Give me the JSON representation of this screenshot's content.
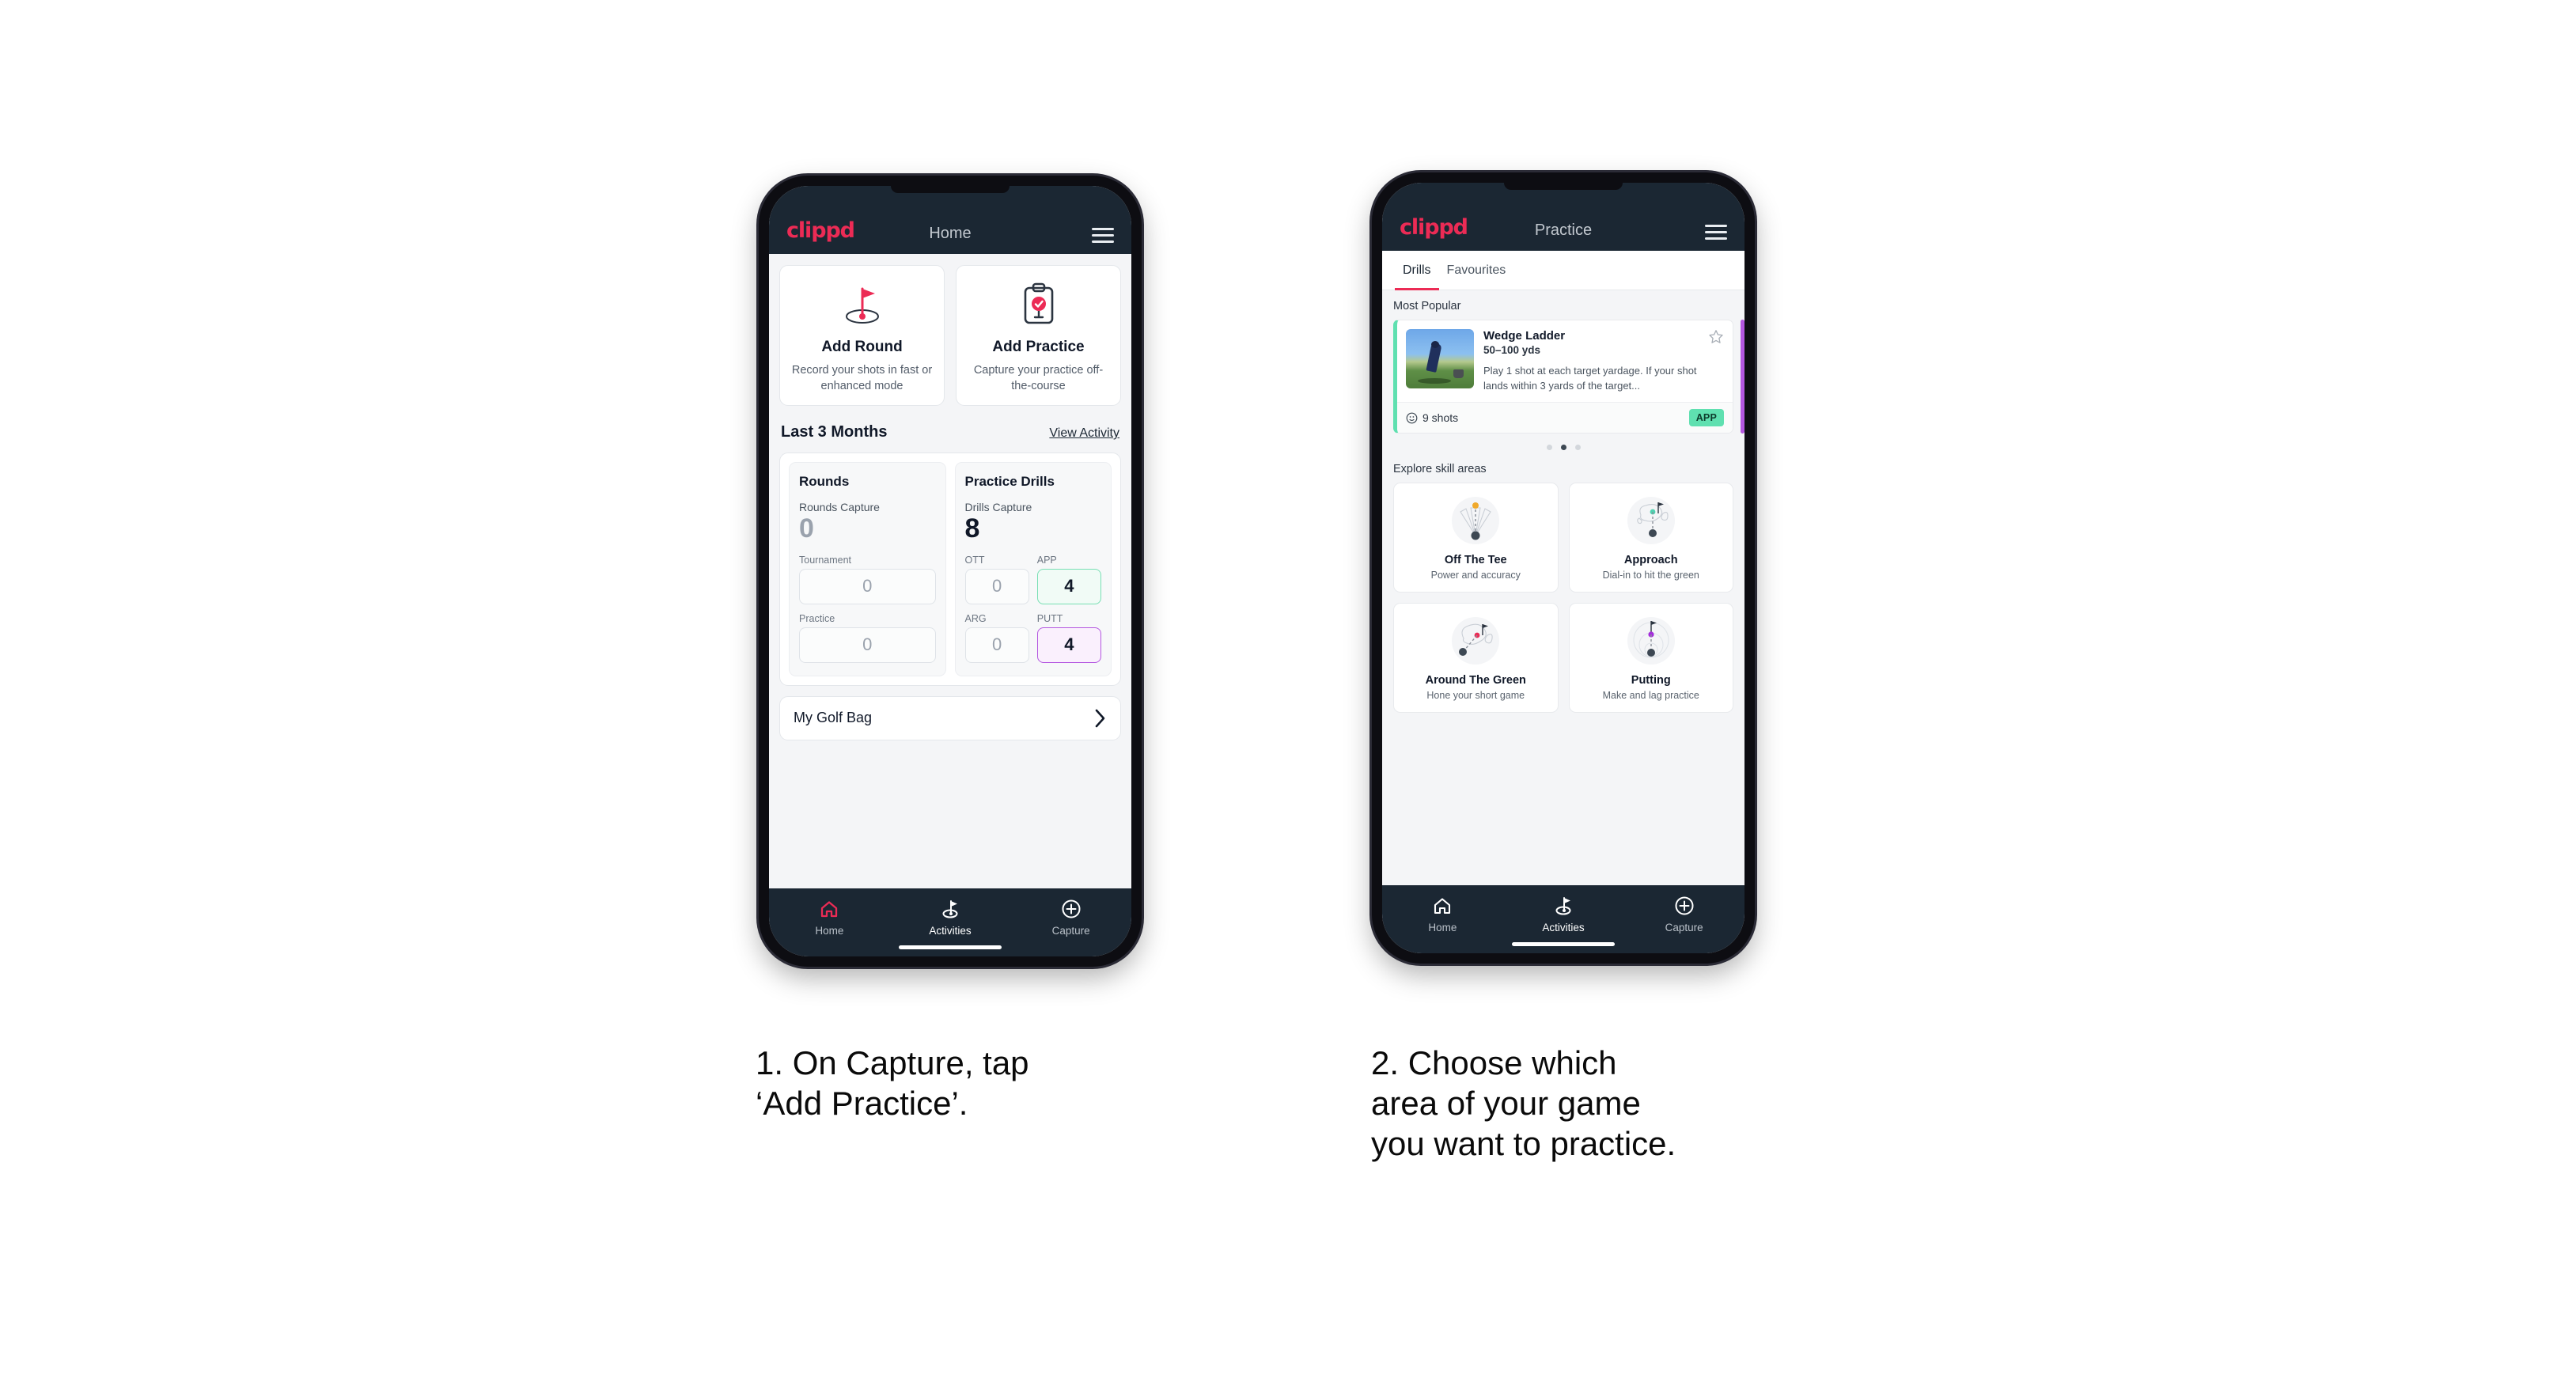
{
  "brand": "clippd",
  "phone1": {
    "appbar": {
      "title": "Home",
      "menu_icon": "hamburger-menu-icon"
    },
    "actions": [
      {
        "icon": "golf-flag-hole-icon",
        "title": "Add Round",
        "desc": "Record your shots in fast or enhanced mode"
      },
      {
        "icon": "clipboard-check-icon",
        "title": "Add Practice",
        "desc": "Capture your practice off-the-course"
      }
    ],
    "section": {
      "title": "Last 3 Months",
      "link": "View Activity"
    },
    "rounds": {
      "heading": "Rounds",
      "capture_label": "Rounds Capture",
      "capture_value": "0",
      "minis": [
        {
          "label": "Tournament",
          "value": "0",
          "style": "plain"
        },
        {
          "label": "Practice",
          "value": "0",
          "style": "plain"
        }
      ]
    },
    "drills": {
      "heading": "Practice Drills",
      "capture_label": "Drills Capture",
      "capture_value": "8",
      "minis": [
        {
          "label": "OTT",
          "value": "0",
          "style": "plain"
        },
        {
          "label": "APP",
          "value": "4",
          "style": "green"
        },
        {
          "label": "ARG",
          "value": "0",
          "style": "plain"
        },
        {
          "label": "PUTT",
          "value": "4",
          "style": "purple"
        }
      ]
    },
    "golfbag": {
      "label": "My Golf Bag",
      "icon": "chevron-right-icon"
    },
    "nav": [
      {
        "icon": "home-icon",
        "label": "Home",
        "active": true
      },
      {
        "icon": "golf-flag-icon",
        "label": "Activities",
        "active": false
      },
      {
        "icon": "plus-circle-icon",
        "label": "Capture",
        "active": false
      }
    ]
  },
  "phone2": {
    "appbar": {
      "title": "Practice",
      "menu_icon": "hamburger-menu-icon"
    },
    "tabs": [
      {
        "label": "Drills",
        "active": true
      },
      {
        "label": "Favourites",
        "active": false
      }
    ],
    "most_popular_label": "Most Popular",
    "drill": {
      "name": "Wedge Ladder",
      "yardage": "50–100 yds",
      "description": "Play 1 shot at each target yardage. If your shot lands within 3 yards of the target...",
      "shots": "9 shots",
      "shots_icon": "clock-icon",
      "badge": "APP",
      "star_icon": "star-outline-icon",
      "accent_color": "#5fe0b0",
      "thumb": "golfer-chipping-photo"
    },
    "carousel_dots": {
      "count": 3,
      "active_index": 1
    },
    "skill_areas_label": "Explore skill areas",
    "skill_areas": [
      {
        "icon": "off-the-tee-icon",
        "name": "Off The Tee",
        "desc": "Power and accuracy",
        "dot_color": "#f0a92b"
      },
      {
        "icon": "approach-green-icon",
        "name": "Approach",
        "desc": "Dial-in to hit the green",
        "dot_color": "#4fd1b0"
      },
      {
        "icon": "around-the-green-icon",
        "name": "Around The Green",
        "desc": "Hone your short game",
        "dot_color": "#ec2b55"
      },
      {
        "icon": "putting-icon",
        "name": "Putting",
        "desc": "Make and lag practice",
        "dot_color": "#a32ddb"
      }
    ],
    "nav": [
      {
        "icon": "home-icon",
        "label": "Home",
        "active": false
      },
      {
        "icon": "golf-flag-icon",
        "label": "Activities",
        "active": true
      },
      {
        "icon": "plus-circle-icon",
        "label": "Capture",
        "active": false
      }
    ]
  },
  "captions": {
    "one": "1. On Capture, tap\n‘Add Practice’.",
    "two": "2. Choose which\narea of your game\nyou want to practice."
  },
  "colors": {
    "brand_pink": "#ec2b55",
    "appbar_dark": "#1b2733",
    "mint": "#5fe0b0",
    "purple": "#b457e0",
    "page_bg": "#f4f5f7"
  }
}
